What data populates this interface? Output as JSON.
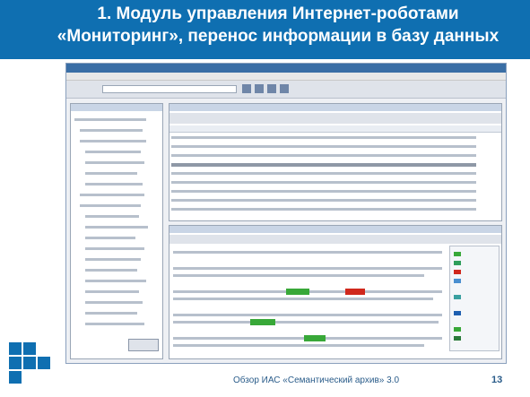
{
  "slide": {
    "title_line1": "1. Модуль управления Интернет-роботами",
    "title_line2": "«Мониторинг», перенос  информации в базу данных",
    "footer": "Обзор ИАС «Семантический архив» 3.0",
    "page_number": "13",
    "colors": {
      "header": "#0f6fb1",
      "footer_text": "#2a5c8a"
    }
  }
}
